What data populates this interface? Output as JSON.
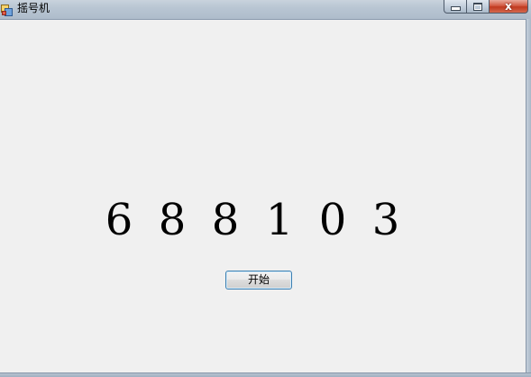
{
  "window": {
    "title": "摇号机",
    "close_glyph": "x"
  },
  "main": {
    "digits": [
      "6",
      "8",
      "8",
      "1",
      "0",
      "3"
    ],
    "start_button_label": "开始"
  },
  "colors": {
    "background": "#f0f0f0",
    "button_border": "#3c7fb1",
    "close_button": "#c0391f"
  }
}
